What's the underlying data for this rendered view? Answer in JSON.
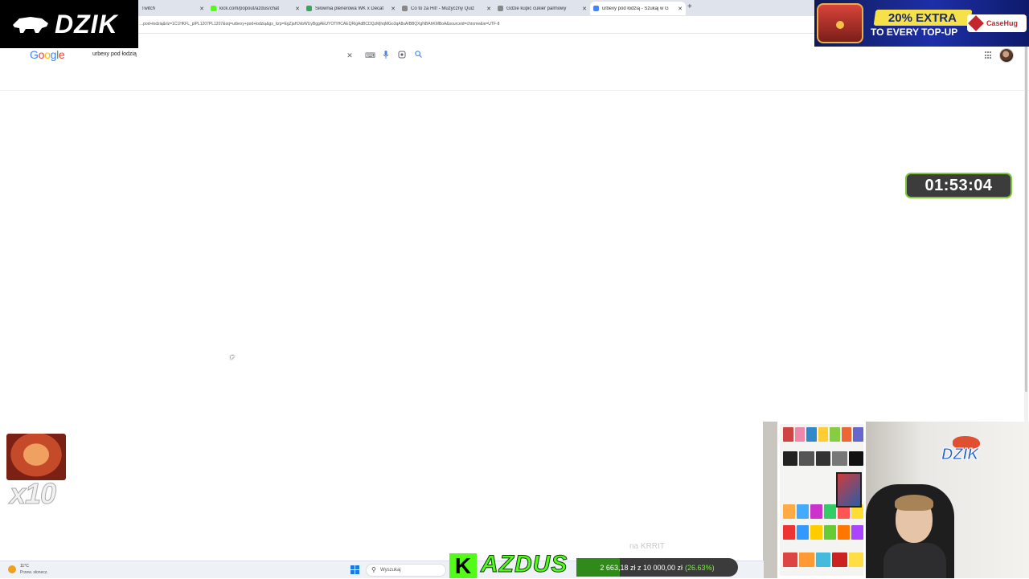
{
  "browser": {
    "tabs": [
      {
        "title": "Twitch",
        "favicon_color": "#9146ff",
        "active": false
      },
      {
        "title": "kick.com/popout/azdus/chat",
        "favicon_color": "#53fc18",
        "active": false
      },
      {
        "title": "Siłownia plenerowa WK x Decat",
        "favicon_color": "#34a853",
        "active": false
      },
      {
        "title": "Co to za Hit! - Muzyczny Quiz",
        "favicon_color": "#888888",
        "active": false
      },
      {
        "title": "Gdzie kupić cukier palmowy",
        "favicon_color": "#888888",
        "active": false
      },
      {
        "title": "urbexy pod łodzią - Szukaj w G",
        "favicon_color": "#4285f4",
        "active": true
      }
    ],
    "new_tab_label": "+",
    "url": "...pod+łodzią&rlz=1C1HKFL_plPL1207PL1207&oq=urbexy+pod+łodzią&gs_lcrp=EgZjaHJvbWUyBggAEUYOTIHCAEQRigAdBCDQzMjhqMGo3qA8sAIBBQXgNBAhKMBoA&sourceid=chrome&ie=UTF-8"
  },
  "google": {
    "logo": "Google",
    "logo_colors": [
      "#4285f4",
      "#ea4335",
      "#fbbc05",
      "#4285f4",
      "#34a853",
      "#ea4335"
    ],
    "search_query": "urbexy pod łodzią",
    "icons": [
      "clear-icon",
      "keyboard-icon",
      "mic-icon",
      "lens-icon",
      "search-icon"
    ]
  },
  "overlays": {
    "dzik_logo": "DZIK",
    "promo": {
      "extra": "20% EXTRA",
      "topup": "TO EVERY TOP-UP",
      "brand": "CaseHug"
    },
    "timer": "01:53:04",
    "emote_multiplier": "x10",
    "webcam_logo": "DZIK",
    "webcam_watermark": "na KRRIT"
  },
  "taskbar": {
    "weather_temp": "11°C",
    "weather_desc": "Przew. słonecz.",
    "search_placeholder": "Wyszukaj"
  },
  "donation_goal": {
    "channel": "AZDUS",
    "logo_letter": "K",
    "current": "2 663,18 zł",
    "separator": "z",
    "target": "10 000,00 zł",
    "percent_text": "(26.63%)",
    "progress": 0.2663,
    "accent": "#53fc18"
  }
}
